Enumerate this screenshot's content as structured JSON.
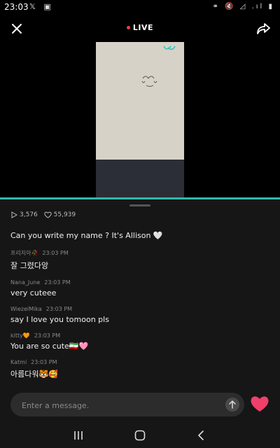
{
  "status_bar": {
    "time": "23:03",
    "left_icons": "𝕏 ▣",
    "right_icons": "⚭ 🔇 ◿ .ıl ▮"
  },
  "header": {
    "live_label": "LIVE"
  },
  "stats": {
    "plays": "3,576",
    "likes": "55,939"
  },
  "chat": {
    "first_message": "Can you write my name ? It's Allison 🤍",
    "messages": [
      {
        "user": "프리지아🥀",
        "time": "23:03 PM",
        "text": "잘 그렸다앙"
      },
      {
        "user": "Nana_June",
        "time": "23:03 PM",
        "text": "very cuteee"
      },
      {
        "user": "WiezelMika",
        "time": "23:03 PM",
        "text": "say I love you tomoon pls"
      },
      {
        "user": "kitty🧡",
        "time": "23:03 PM",
        "text": "You are so cute🇮🇷🩷"
      },
      {
        "user": "Katmi",
        "time": "23:03 PM",
        "text": "아름다워🐯🥰"
      }
    ]
  },
  "input": {
    "placeholder": "Enter a message."
  },
  "colors": {
    "accent": "#2fb9a9",
    "live_dot": "#e8433a",
    "heart": "#f0406a"
  },
  "icons": {
    "close": "close-icon",
    "share": "share-icon",
    "play": "play-icon",
    "like": "heart-outline-icon",
    "send": "arrow-up-icon",
    "heart_button": "heart-icon",
    "nav_recents": "recents-icon",
    "nav_home": "home-icon",
    "nav_back": "back-icon"
  }
}
